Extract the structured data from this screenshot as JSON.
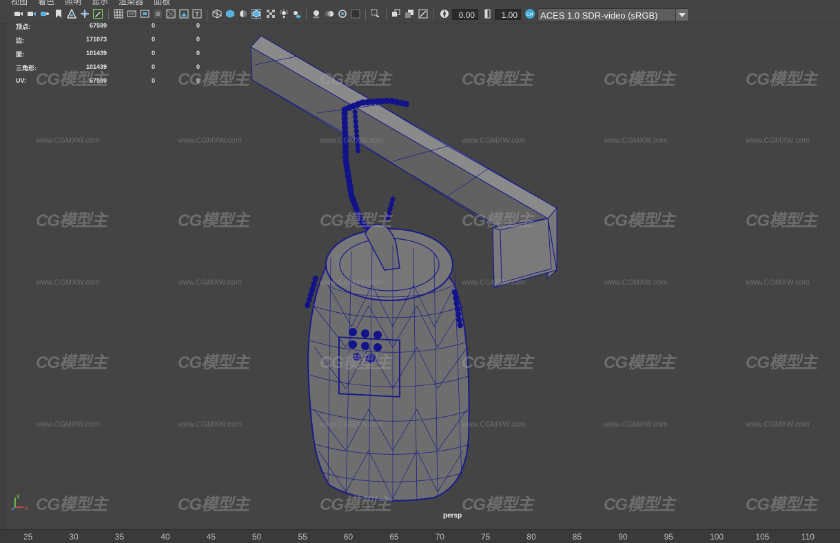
{
  "menu": [
    "视图",
    "着色",
    "照明",
    "显示",
    "渲染器",
    "面板"
  ],
  "toolbar": {
    "exposure_value": "0.00",
    "gamma_value": "1.00",
    "color_space": "ACES 1.0 SDR-video (sRGB)"
  },
  "stats": [
    {
      "label": "顶点:",
      "v1": "67599",
      "v2": "0",
      "v3": "0"
    },
    {
      "label": "边:",
      "v1": "171073",
      "v2": "0",
      "v3": "0"
    },
    {
      "label": "面:",
      "v1": "101439",
      "v2": "0",
      "v3": "0"
    },
    {
      "label": "三角形:",
      "v1": "101439",
      "v2": "0",
      "v3": "0"
    },
    {
      "label": "UV:",
      "v1": "67599",
      "v2": "0",
      "v3": "0"
    }
  ],
  "camera_name": "persp",
  "watermark": {
    "logo": "CG模型主",
    "url": "www.CGMXW.com"
  },
  "ruler_ticks": [
    "25",
    "30",
    "35",
    "40",
    "45",
    "50",
    "55",
    "60",
    "65",
    "70",
    "75",
    "80",
    "85",
    "90",
    "95",
    "100",
    "105",
    "110"
  ],
  "colors": {
    "wireframe": "#1a1a8c",
    "viewport": "#444444",
    "accent": "#3fa8d8"
  }
}
